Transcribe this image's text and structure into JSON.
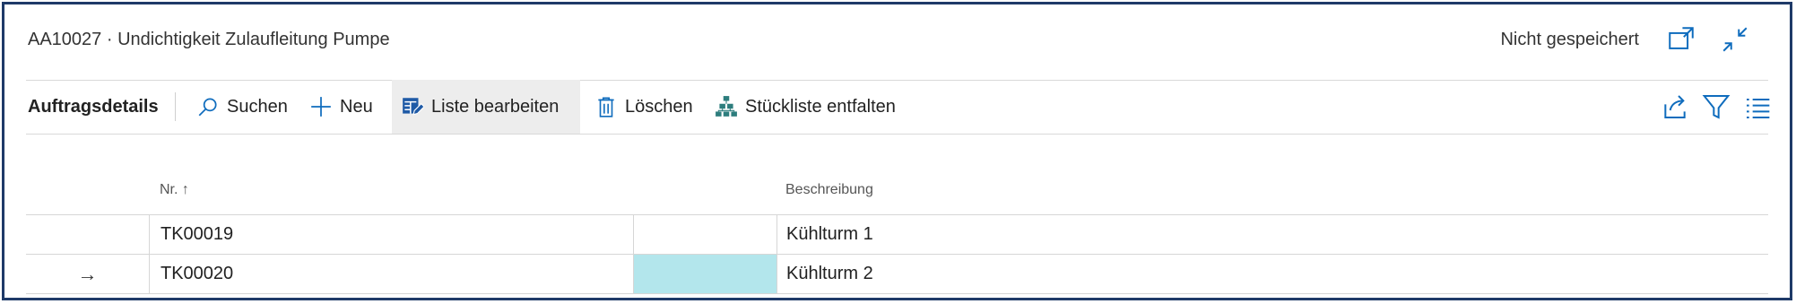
{
  "page": {
    "title": "AA10027 · Undichtigkeit Zulaufleitung Pumpe",
    "save_status": "Nicht gespeichert"
  },
  "icons": {
    "open_in_new": "open-in-new-window-icon",
    "collapse": "collapse-icon",
    "share": "share-icon",
    "filter": "filter-icon",
    "list_view": "list-view-icon"
  },
  "toolbar": {
    "section_title": "Auftragsdetails",
    "search": "Suchen",
    "new": "Neu",
    "edit_list": "Liste bearbeiten",
    "delete": "Löschen",
    "explode_bom": "Stückliste entfalten"
  },
  "table": {
    "columns": [
      "Nr. ↑",
      "Beschreibung"
    ],
    "rows": [
      {
        "selector": "",
        "nr": "TK00019",
        "beschreibung": "Kühlturm 1"
      },
      {
        "selector": "→",
        "nr": "TK00020",
        "beschreibung": "Kühlturm 2"
      }
    ]
  },
  "colors": {
    "frame_border": "#1f3a68",
    "accent": "#0f6cbd",
    "bom_icon": "#2d7d7d",
    "active_cell": "#b3e6ec"
  }
}
